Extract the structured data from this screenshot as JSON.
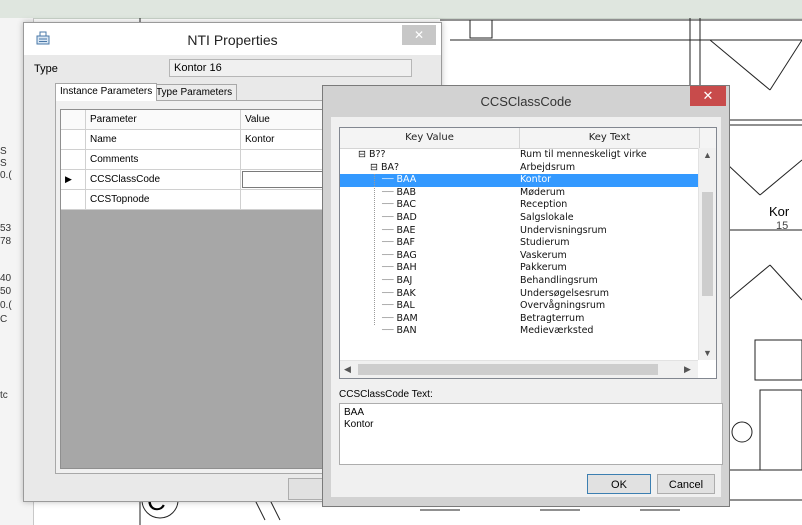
{
  "nti_dialog": {
    "title": "NTI Properties",
    "close_glyph": "✕",
    "type_label": "Type",
    "type_value": "Kontor 16",
    "tabs": [
      {
        "label": "Instance Parameters",
        "active": true
      },
      {
        "label": "Type Parameters",
        "active": false
      }
    ],
    "grid": {
      "headers": [
        "Parameter",
        "Value"
      ],
      "rows": [
        {
          "indicator": "",
          "parameter": "Name",
          "value": "Kontor"
        },
        {
          "indicator": "",
          "parameter": "Comments",
          "value": ""
        },
        {
          "indicator": "▶",
          "parameter": "CCSClassCode",
          "value": ""
        },
        {
          "indicator": "",
          "parameter": "CCSTopnode",
          "value": ""
        }
      ]
    },
    "ok_partial": "O"
  },
  "ccs_dialog": {
    "title": "CCSClassCode",
    "close_glyph": "✕",
    "columns": [
      "Key Value",
      "Key Text"
    ],
    "tree": [
      {
        "key": "B??",
        "text": "Rum til menneskeligt virke",
        "level": 0,
        "expander": "⊟",
        "selected": false
      },
      {
        "key": "BA?",
        "text": "Arbejdsrum",
        "level": 1,
        "expander": "⊟",
        "selected": false
      },
      {
        "key": "BAA",
        "text": "Kontor",
        "level": 2,
        "expander": "",
        "selected": true
      },
      {
        "key": "BAB",
        "text": "Møderum",
        "level": 2,
        "expander": "",
        "selected": false
      },
      {
        "key": "BAC",
        "text": "Reception",
        "level": 2,
        "expander": "",
        "selected": false
      },
      {
        "key": "BAD",
        "text": "Salgslokale",
        "level": 2,
        "expander": "",
        "selected": false
      },
      {
        "key": "BAE",
        "text": "Undervisningsrum",
        "level": 2,
        "expander": "",
        "selected": false
      },
      {
        "key": "BAF",
        "text": "Studierum",
        "level": 2,
        "expander": "",
        "selected": false
      },
      {
        "key": "BAG",
        "text": "Vaskerum",
        "level": 2,
        "expander": "",
        "selected": false
      },
      {
        "key": "BAH",
        "text": "Pakkerum",
        "level": 2,
        "expander": "",
        "selected": false
      },
      {
        "key": "BAJ",
        "text": "Behandlingsrum",
        "level": 2,
        "expander": "",
        "selected": false
      },
      {
        "key": "BAK",
        "text": "Undersøgelsesrum",
        "level": 2,
        "expander": "",
        "selected": false
      },
      {
        "key": "BAL",
        "text": "Overvågningsrum",
        "level": 2,
        "expander": "",
        "selected": false
      },
      {
        "key": "BAM",
        "text": "Betragterrum",
        "level": 2,
        "expander": "",
        "selected": false
      },
      {
        "key": "BAN",
        "text": "Medieværksted",
        "level": 2,
        "expander": "",
        "selected": false
      }
    ],
    "code_text_label": "CCSClassCode Text:",
    "code_text_value": "BAA\nKontor",
    "ok_label": "OK",
    "cancel_label": "Cancel"
  },
  "background": {
    "room_label": "Kor",
    "room_number": "15",
    "grid_letter": "C",
    "left_strip_glyphs": [
      "S",
      "S",
      "0.(",
      "53",
      "78",
      "40",
      "50",
      "0.(",
      "C",
      "tc"
    ]
  },
  "colors": {
    "selection": "#3399ff",
    "close_red": "#c84b4b"
  }
}
